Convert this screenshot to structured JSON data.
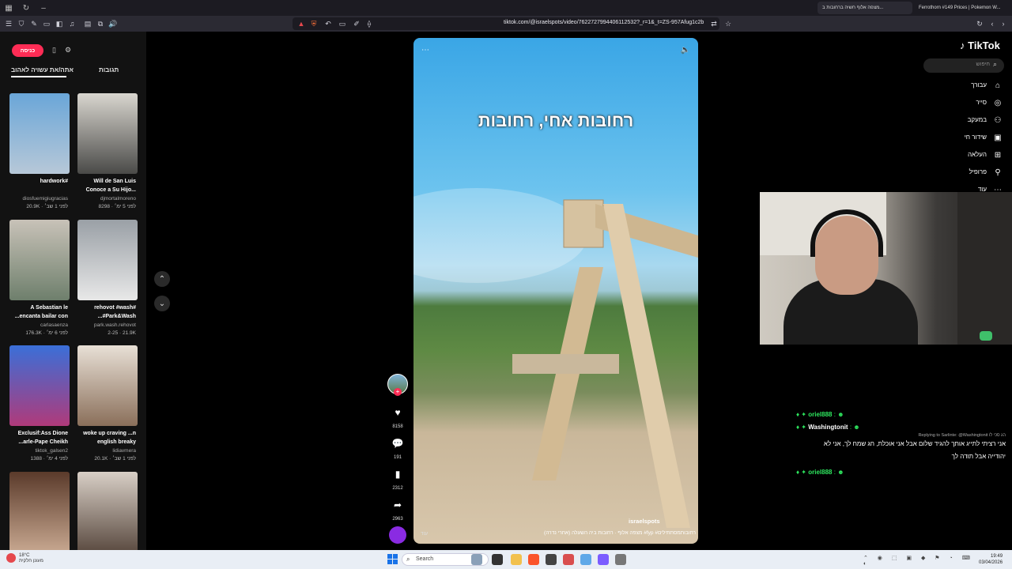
{
  "browser": {
    "active_tab_title": "מצפה אלוף חשיה ברחובות ב...",
    "other_tab_title": "Ferrothorn #149 Prices | Pokemon W...",
    "url": "tiktok.com/@israelspots/video/7622727994406112532?_r=1&_t=ZS-957Afug1c2b"
  },
  "left_panel": {
    "login_label": "כניסה",
    "tabs": [
      {
        "label": "אתה/את עשויה לאהוב"
      },
      {
        "label": "תגובות"
      }
    ],
    "videos": [
      {
        "caption": "hardwork#",
        "author": "diosfuemigiugracias",
        "meta": "20.9K · לפני 1 שב׳",
        "colors": [
          "#6aa6d8",
          "#b7c8d8"
        ]
      },
      {
        "caption": "Will de San Luis Conoce a Su Hijo...",
        "author": "djmortalmoreno",
        "meta": "8298 · לפני 5 ימ׳",
        "colors": [
          "#d9d6cf",
          "#4a4a48"
        ]
      },
      {
        "caption": "A Sebastian le ...encanta bailar con",
        "author": "carlasaenza",
        "meta": "176.3K · לפני 6 ימ׳",
        "colors": [
          "#c8c2b8",
          "#6e7f6c"
        ]
      },
      {
        "caption": "rehovot #wash# ...#Park&Wash",
        "author": "park.wash.rehovot",
        "meta": "2-25 · 21.9K",
        "colors": [
          "#9aa0a6",
          "#e8e8e8"
        ]
      },
      {
        "caption": "Exclusif:Ass Dione ...arle-Pape Cheikh",
        "author": "tiktok_galsen2",
        "meta": "1388 · לפני 4 ימ׳",
        "colors": [
          "#3a6fd8",
          "#b03a7a"
        ]
      },
      {
        "caption": "woke up craving ...n english breaky",
        "author": "lidiavmera",
        "meta": "20.1K · לפני 1 שב׳",
        "colors": [
          "#e8e0d6",
          "#8a6f5a"
        ]
      },
      {
        "caption": "",
        "author": "",
        "meta": "",
        "colors": [
          "#5a3a2a",
          "#c8a890"
        ]
      },
      {
        "caption": "",
        "author": "",
        "meta": "",
        "colors": [
          "#d8cfc6",
          "#5a4a40"
        ]
      }
    ]
  },
  "video": {
    "overlay_title": "רחובות אחי, רחובות",
    "author": "israelspots",
    "description": "מצפה אלוף · רחובות ביה השעלה (אחרי נדרה) #fyp #רחובותמסתתילים",
    "actions": [
      {
        "icon": "heart-icon",
        "glyph": "♥",
        "count": "8158"
      },
      {
        "icon": "comment-icon",
        "glyph": "💬",
        "count": "191"
      },
      {
        "icon": "bookmark-icon",
        "glyph": "▮",
        "count": "2312"
      },
      {
        "icon": "share-icon",
        "glyph": "➦",
        "count": "2963"
      }
    ]
  },
  "right_nav": {
    "logo": "TikTok",
    "search_placeholder": "חיפוש",
    "items": [
      {
        "label": "עבורך",
        "icon": "home-icon",
        "glyph": "⌂"
      },
      {
        "label": "סייר",
        "icon": "compass-icon",
        "glyph": "◎"
      },
      {
        "label": "במעקב",
        "icon": "following-icon",
        "glyph": "⚇"
      },
      {
        "label": "שידור חי",
        "icon": "live-icon",
        "glyph": "▣"
      },
      {
        "label": "העלאה",
        "icon": "upload-icon",
        "glyph": "⊞"
      },
      {
        "label": "פרופיל",
        "icon": "profile-icon",
        "glyph": "⚲"
      },
      {
        "label": "עוד",
        "icon": "more-icon",
        "glyph": "⋯"
      }
    ]
  },
  "chat": [
    {
      "user": "oriel888",
      "message": ""
    },
    {
      "user": "Washingtonit",
      "message": ""
    },
    {
      "user": "",
      "message": "Replying to Sarlinte: @Washingtonit הג סכי לו"
    },
    {
      "user": "",
      "message": "אני רציתי לתייג אותך להגיד שלום אבל אני אוכלת, חג שמח לך, אני לא"
    },
    {
      "user": "",
      "message": "יהודייה אבל תודה לך"
    },
    {
      "user": "oriel888",
      "message": ""
    }
  ],
  "taskbar": {
    "weather_temp": "18°C",
    "weather_desc": "מעונן חלקית",
    "search_label": "Search",
    "time": "19:49",
    "date": "03/04/2026"
  }
}
